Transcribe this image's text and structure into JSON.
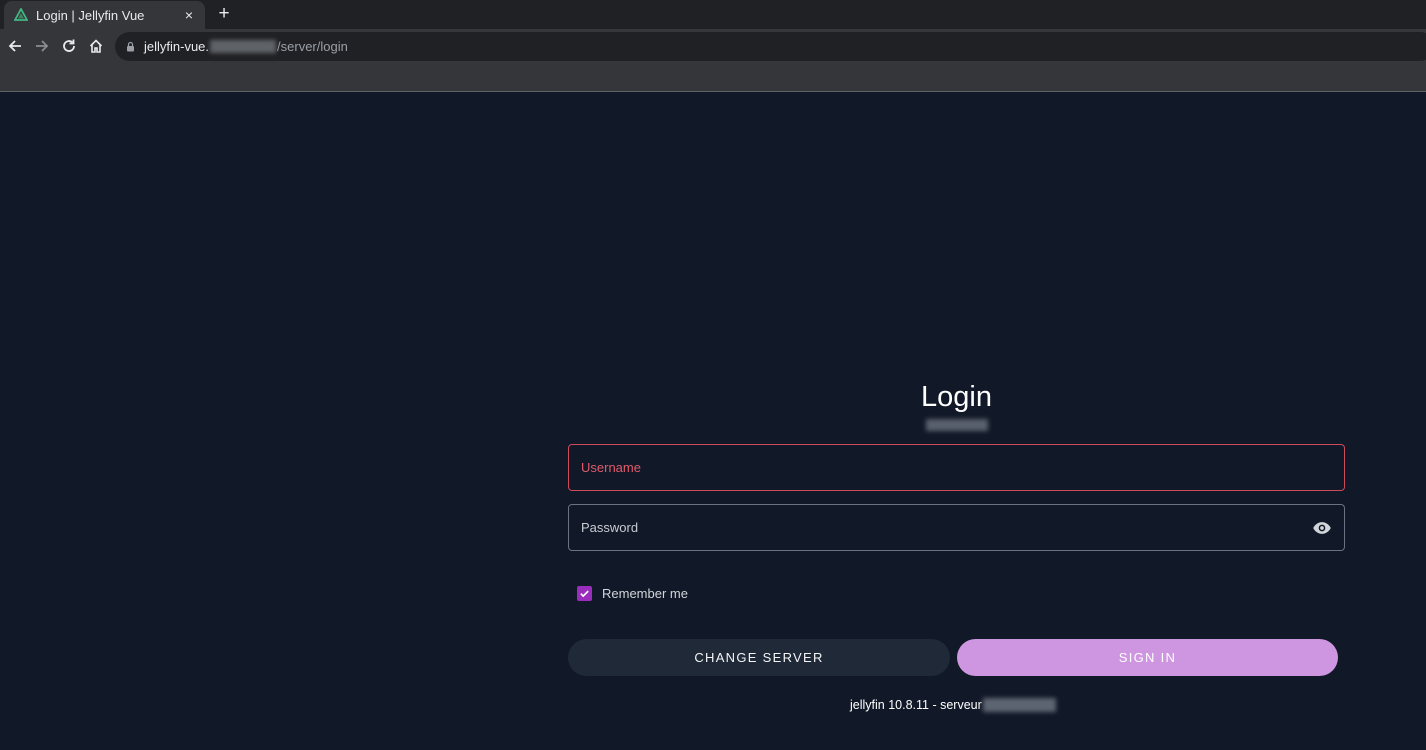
{
  "browser": {
    "tab_title": "Login | Jellyfin Vue",
    "tab_close": "×",
    "new_tab": "+",
    "url_host": "jellyfin-vue.",
    "url_path": "/server/login",
    "favicon": "vue-icon",
    "accent": "#42b883"
  },
  "login": {
    "title": "Login",
    "username_label": "Username",
    "password_label": "Password",
    "remember_label": "Remember me",
    "remember_checked": true,
    "change_server_label": "CHANGE SERVER",
    "sign_in_label": "SIGN IN"
  },
  "footer": {
    "version_text": "jellyfin 10.8.11 - serveur"
  },
  "colors": {
    "background": "#111827",
    "primary": "#9b2dbd",
    "sign_in_bg": "#ce96e0",
    "error": "#cf4a5a"
  }
}
